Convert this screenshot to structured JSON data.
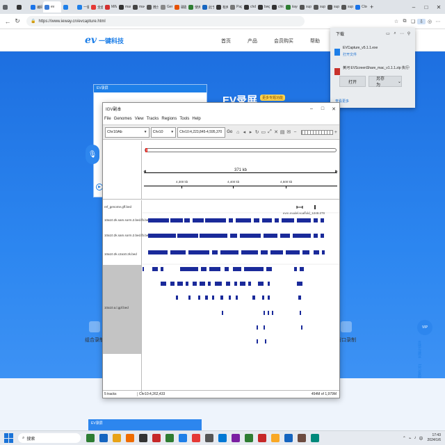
{
  "browser": {
    "tabs": [
      {
        "label": "",
        "color": "#5f6368"
      },
      {
        "label": "",
        "color": "#333333"
      },
      {
        "label": "编码",
        "color": "#1a73e8"
      },
      {
        "label": "ev",
        "color": "#3a7bd5"
      },
      {
        "label": "",
        "color": "#1e7fe8"
      },
      {
        "label": "一键",
        "color": "#1e7fe8"
      },
      {
        "label": "全面",
        "color": "#e53935"
      },
      {
        "label": "MIM",
        "color": "#d32f2f"
      },
      {
        "label": "mam",
        "color": "#333333"
      },
      {
        "label": "ma4",
        "color": "#444444"
      },
      {
        "label": "微分",
        "color": "#555555"
      },
      {
        "label": "Geno",
        "color": "#888888"
      },
      {
        "label": "磷酸",
        "color": "#e65100"
      },
      {
        "label": "使用",
        "color": "#2e7d32"
      },
      {
        "label": "此于",
        "color": "#1565c0"
      },
      {
        "label": "有两",
        "color": "#333333"
      },
      {
        "label": "Page",
        "color": "#777777"
      },
      {
        "label": "chdo",
        "color": "#333333"
      },
      {
        "label": "bwg",
        "color": "#333333"
      },
      {
        "label": "chlo",
        "color": "#333333"
      },
      {
        "label": "iiaye",
        "color": "#2e7d32"
      },
      {
        "label": "supp",
        "color": "#555555"
      },
      {
        "label": "supp",
        "color": "#555555"
      },
      {
        "label": "supp",
        "color": "#555555"
      },
      {
        "label": "supp",
        "color": "#555555"
      },
      {
        "label": "Cloc",
        "color": "#1a73e8"
      }
    ],
    "url": "https://www.ieway.cn/evcapture.html",
    "window_controls": [
      "–",
      "□",
      "✕"
    ]
  },
  "site": {
    "logo_mark": "ev",
    "logo_text": "一键科技",
    "nav": [
      "首页",
      "产品",
      "会员购买",
      "帮助"
    ],
    "hero_title": "EV录屏",
    "hero_badge": "更多专题功能",
    "features": [
      "组合录制",
      "窗口录制"
    ],
    "float_items": [
      "反馈与建议",
      "1对1客服"
    ],
    "float_circle": "VIP"
  },
  "downloads": {
    "title": "下载",
    "items": [
      {
        "name": "EVCapture_v5.1.1.exe",
        "sub": "打开文件"
      },
      {
        "name": "黄河 EVScreenShare_mac_v1.1.1.zip 执行什么...",
        "sub": ""
      }
    ],
    "open_label": "打开",
    "saveas_label": "另存为",
    "more_label": "查看更多"
  },
  "evwin": {
    "title": "EV录屏"
  },
  "igv": {
    "title": "IGV副本",
    "menu": [
      "File",
      "Genomes",
      "View",
      "Tracks",
      "Regions",
      "Tools",
      "Help"
    ],
    "genome": "Chr10Ab",
    "chromosome": "Chr10",
    "locus": "Chr10:4,223,845-4,595,370",
    "go_label": "Go",
    "span_label": "371 kb",
    "ticks": [
      "4,300 kb",
      "4,400 kb",
      "4,500 kb"
    ],
    "track_names": [
      "ref_genome.gff.bed",
      "10a10.2k.sam.sorm.2.bed.fb.bed",
      "10a10.2k.sam.sorm.2.bed.fb.bed",
      "10a10.2k.c2a10.2k.bed",
      "10a10.a.l.gpf.bed"
    ],
    "feature_label": "evm.model.scaffold_1248.278",
    "status": {
      "tracks": "5 tracks",
      "position": "Chr10:4,262,433",
      "memory": "454M of 1,979M"
    }
  },
  "evbar": {
    "title": "EV录屏"
  },
  "taskbar": {
    "search_placeholder": "搜索",
    "apps": [
      "#2d7d32",
      "#1565c0",
      "#e8a317",
      "#ef6c00",
      "#333333",
      "#c62828",
      "#2e7d32",
      "#1e7fe8",
      "#e53935",
      "#555555",
      "#0078d4",
      "#7b1fa2",
      "#2e7d32",
      "#c62828",
      "#f9a825",
      "#1565c0",
      "#6d4c41",
      "#00897b"
    ],
    "time": "17:43",
    "date": "2024/1/6",
    "lang": "中"
  }
}
